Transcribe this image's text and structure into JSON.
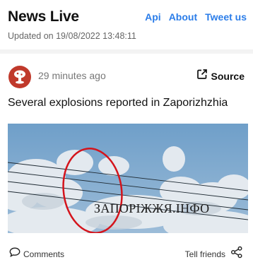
{
  "header": {
    "title": "News Live",
    "updated": "Updated on 19/08/2022 13:48:11",
    "nav": [
      "Api",
      "About",
      "Tweet us"
    ]
  },
  "post": {
    "time_ago": "29 minutes ago",
    "source_label": "Source",
    "headline": "Several explosions reported in Zaporizhzhia",
    "image_watermark": "ЗАПОРІЖЖЯ.ІНФО",
    "comments_label": "Comments",
    "share_label": "Tell friends"
  },
  "colors": {
    "accent": "#2b7de9",
    "avatar": "#c0392b",
    "annotation_circle": "#d4141c"
  },
  "icons": [
    "mushroom-cloud-icon",
    "external-link-icon",
    "comment-bubble-icon",
    "share-icon"
  ]
}
